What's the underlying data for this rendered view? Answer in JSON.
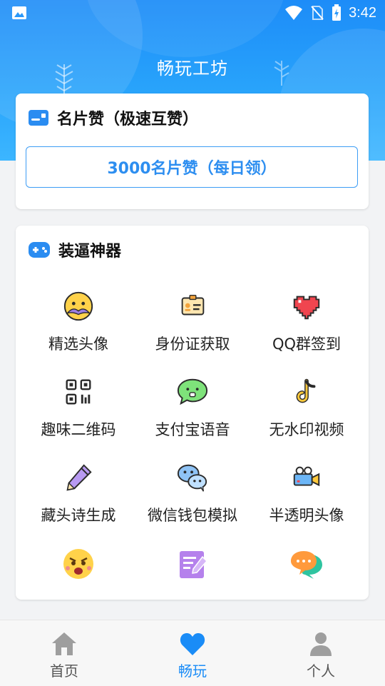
{
  "status_bar": {
    "time": "3:42"
  },
  "header": {
    "title": "畅玩工坊"
  },
  "card_like": {
    "title": "名片赞（极速互赞）",
    "button_label": "3000名片赞（每日领）"
  },
  "card_tools": {
    "title": "装逼神器",
    "items": [
      {
        "label": "精选头像",
        "icon": "mustache-face-icon"
      },
      {
        "label": "身份证获取",
        "icon": "id-card-icon"
      },
      {
        "label": "QQ群签到",
        "icon": "pixel-heart-icon"
      },
      {
        "label": "趣味二维码",
        "icon": "qr-code-icon"
      },
      {
        "label": "支付宝语音",
        "icon": "voice-chat-icon"
      },
      {
        "label": "无水印视频",
        "icon": "tiktok-icon"
      },
      {
        "label": "藏头诗生成",
        "icon": "pencil-icon"
      },
      {
        "label": "微信钱包模拟",
        "icon": "wechat-icon"
      },
      {
        "label": "半透明头像",
        "icon": "video-camera-icon"
      },
      {
        "label": "",
        "icon": "angry-face-icon"
      },
      {
        "label": "",
        "icon": "notepad-icon"
      },
      {
        "label": "",
        "icon": "chat-bubbles-icon"
      }
    ]
  },
  "bottom_nav": {
    "items": [
      {
        "label": "首页",
        "icon": "home-icon",
        "color": "#9e9e9e"
      },
      {
        "label": "畅玩",
        "icon": "heart-icon",
        "color": "#1a8cf7"
      },
      {
        "label": "个人",
        "icon": "person-icon",
        "color": "#9e9e9e"
      }
    ]
  },
  "colors": {
    "accent": "#1d8cf8",
    "button_text": "#2d8ef0"
  }
}
